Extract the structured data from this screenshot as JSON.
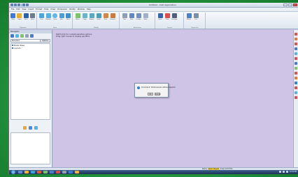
{
  "window": {
    "title": "Untitled - CAD Application"
  },
  "menu": [
    "File",
    "Edit",
    "View",
    "Insert",
    "Format",
    "Tools",
    "Draw",
    "Dimension",
    "Modify",
    "Window",
    "Help"
  ],
  "ribbon": {
    "groups": [
      {
        "name": "Clipboard",
        "buttons": [
          "New",
          "Open",
          "Save",
          "Print"
        ]
      },
      {
        "name": "Draw",
        "buttons": [
          "Line",
          "Polyline",
          "Circle",
          "Arc",
          "Rect"
        ]
      },
      {
        "name": "Modify",
        "buttons": [
          "Move",
          "Copy",
          "Rotate",
          "Scale",
          "Trim",
          "Extend"
        ]
      },
      {
        "name": "Annotation",
        "buttons": [
          "Text",
          "Dim",
          "Leader",
          "Table"
        ]
      },
      {
        "name": "Layers",
        "buttons": [
          "Layer",
          "Color",
          "Linetype"
        ]
      },
      {
        "name": "Properties",
        "buttons": [
          "Match",
          "List"
        ]
      }
    ]
  },
  "dock": {
    "title": "Navigator",
    "combo_value": "Standard",
    "combo_button": "Options",
    "tree": [
      "Model Views",
      "Layouts"
    ]
  },
  "canvas": {
    "hint": "Right-click for context-sensitive options. Drag right mouse to display pan/flick."
  },
  "dialog": {
    "message": "Command: Dimensional outline required",
    "ok": "OK",
    "cancel": "Cancel"
  },
  "status": {
    "prompt_prefix": "Ready",
    "highlight": "Select Objects",
    "suffix": "Snap Grid Ortho"
  },
  "taskbar": {
    "clock": "12:00 PM"
  },
  "colors": {
    "canvas": "#cfc4e6",
    "backdrop": "#24953f",
    "accent": "#2f6fd0"
  }
}
